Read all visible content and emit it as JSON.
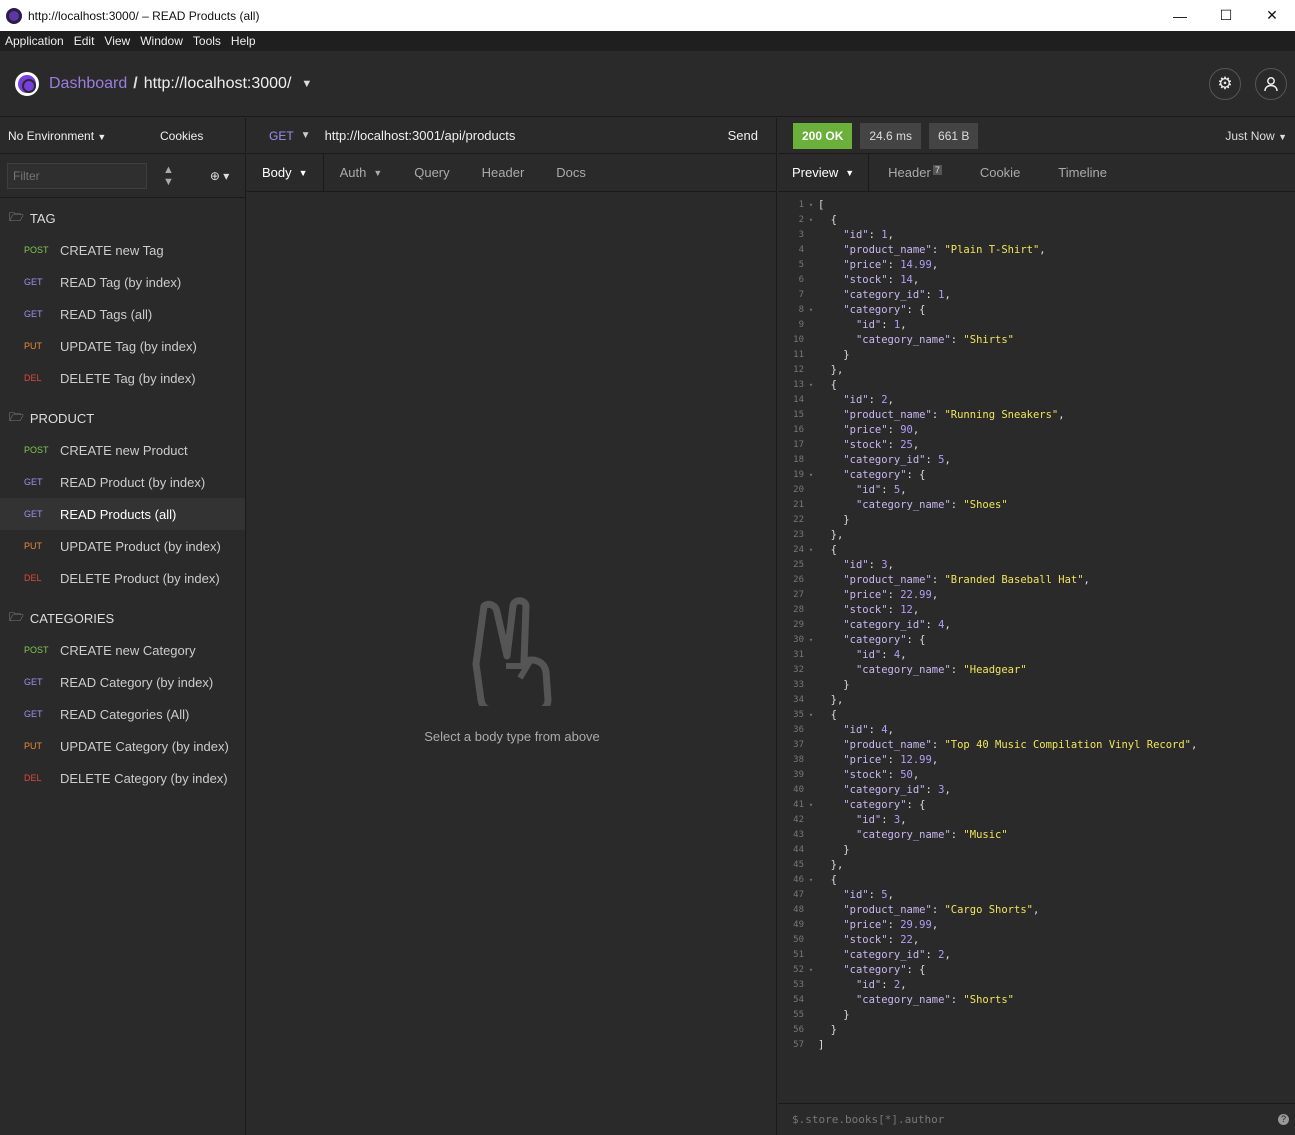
{
  "window": {
    "title": "http://localhost:3000/ – READ Products (all)",
    "minimize": "—",
    "maximize": "☐",
    "close": "✕"
  },
  "menu": [
    "Application",
    "Edit",
    "View",
    "Window",
    "Tools",
    "Help"
  ],
  "header": {
    "dashboard": "Dashboard",
    "separator": "/",
    "workspace": "http://localhost:3000/"
  },
  "sidebar": {
    "environment": "No Environment",
    "cookies": "Cookies",
    "filter_placeholder": "Filter",
    "folders": [
      {
        "name": "TAG",
        "requests": [
          {
            "method": "POST",
            "label": "CREATE new Tag"
          },
          {
            "method": "GET",
            "label": "READ Tag (by index)"
          },
          {
            "method": "GET",
            "label": "READ Tags (all)"
          },
          {
            "method": "PUT",
            "label": "UPDATE Tag (by index)"
          },
          {
            "method": "DEL",
            "label": "DELETE Tag (by index)"
          }
        ]
      },
      {
        "name": "PRODUCT",
        "requests": [
          {
            "method": "POST",
            "label": "CREATE new Product"
          },
          {
            "method": "GET",
            "label": "READ Product (by index)"
          },
          {
            "method": "GET",
            "label": "READ Products (all)"
          },
          {
            "method": "PUT",
            "label": "UPDATE Product (by index)"
          },
          {
            "method": "DEL",
            "label": "DELETE Product (by index)"
          }
        ]
      },
      {
        "name": "CATEGORIES",
        "requests": [
          {
            "method": "POST",
            "label": "CREATE new Category"
          },
          {
            "method": "GET",
            "label": "READ Category (by index)"
          },
          {
            "method": "GET",
            "label": "READ Categories (All)"
          },
          {
            "method": "PUT",
            "label": "UPDATE Category (by index)"
          },
          {
            "method": "DEL",
            "label": "DELETE Category (by index)"
          }
        ]
      }
    ]
  },
  "request": {
    "method": "GET",
    "url": "http://localhost:3001/api/products",
    "send": "Send",
    "tabs": [
      "Body",
      "Auth",
      "Query",
      "Header",
      "Docs"
    ],
    "empty_text": "Select a body type from above"
  },
  "response": {
    "status": "200 OK",
    "time": "24.6 ms",
    "size": "661 B",
    "when": "Just Now",
    "tabs": [
      "Preview",
      "Header",
      "Cookie",
      "Timeline"
    ],
    "header_count": "7",
    "filter_placeholder": "$.store.books[*].author",
    "help": "?",
    "products": [
      {
        "id": 1,
        "product_name": "Plain T-Shirt",
        "price": 14.99,
        "stock": 14,
        "category_id": 1,
        "category": {
          "id": 1,
          "category_name": "Shirts"
        }
      },
      {
        "id": 2,
        "product_name": "Running Sneakers",
        "price": 90,
        "stock": 25,
        "category_id": 5,
        "category": {
          "id": 5,
          "category_name": "Shoes"
        }
      },
      {
        "id": 3,
        "product_name": "Branded Baseball Hat",
        "price": 22.99,
        "stock": 12,
        "category_id": 4,
        "category": {
          "id": 4,
          "category_name": "Headgear"
        }
      },
      {
        "id": 4,
        "product_name": "Top 40 Music Compilation Vinyl Record",
        "price": 12.99,
        "stock": 50,
        "category_id": 3,
        "category": {
          "id": 3,
          "category_name": "Music"
        }
      },
      {
        "id": 5,
        "product_name": "Cargo Shorts",
        "price": 29.99,
        "stock": 22,
        "category_id": 2,
        "category": {
          "id": 2,
          "category_name": "Shorts"
        }
      }
    ]
  },
  "colors": {
    "post": "#7ec850",
    "get": "#a18df0",
    "put": "#e58c3a",
    "del": "#e0493b",
    "status_ok": "#6ab03a",
    "accent": "#7a3ee0"
  },
  "active_request": "READ Products (all)"
}
